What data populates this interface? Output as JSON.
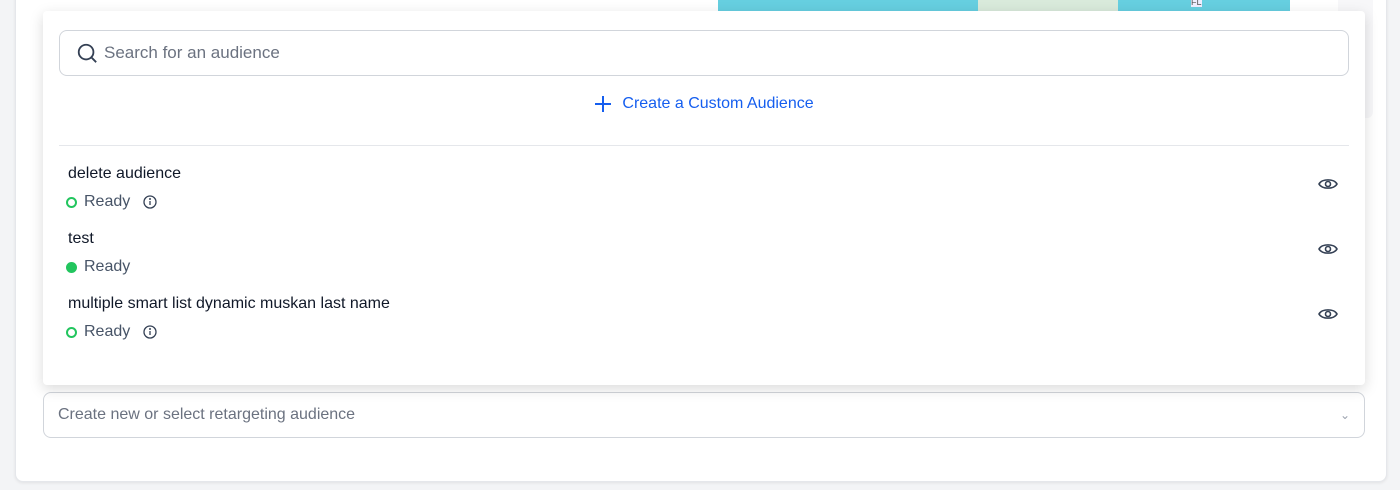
{
  "map": {
    "label": "FL"
  },
  "dropdown": {
    "search_placeholder": "Search for an audience",
    "create_label": "Create a Custom Audience",
    "items": [
      {
        "name": "delete audience",
        "status": "Ready",
        "status_style": "outline",
        "info": true
      },
      {
        "name": "test",
        "status": "Ready",
        "status_style": "filled",
        "info": false
      },
      {
        "name": "multiple smart list dynamic muskan last name",
        "status": "Ready",
        "status_style": "outline",
        "info": true
      }
    ]
  },
  "select": {
    "placeholder": "Create new or select retargeting audience"
  },
  "colors": {
    "accent": "#155eef",
    "ready": "#22c55e"
  }
}
